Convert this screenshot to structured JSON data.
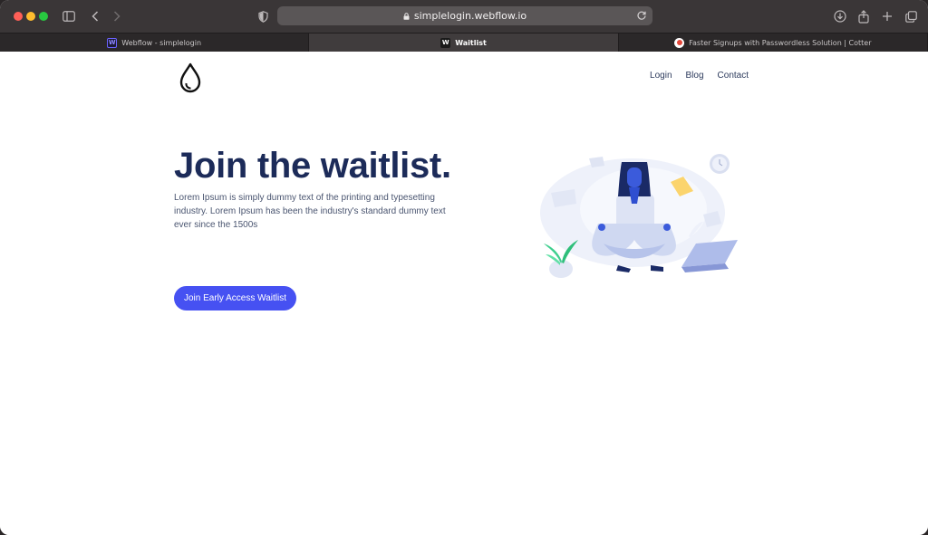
{
  "browser": {
    "url": "simplelogin.webflow.io",
    "tabs": [
      {
        "label": "Webflow - simplelogin",
        "favicon": "W",
        "active": false
      },
      {
        "label": "Waitlist",
        "favicon": "W",
        "active": true
      },
      {
        "label": "Faster Signups with Passwordless Solution | Cotter",
        "favicon": "cotter-icon",
        "active": false
      }
    ]
  },
  "nav": {
    "login": "Login",
    "blog": "Blog",
    "contact": "Contact"
  },
  "hero": {
    "title": "Join the waitlist.",
    "description": "Lorem Ipsum is simply dummy text of the printing and typesetting industry. Lorem Ipsum has been the industry's standard dummy text ever since the 1500s",
    "cta_label": "Join Early Access Waitlist"
  },
  "colors": {
    "accent": "#4651f2",
    "heading": "#1c2b59",
    "toolbar": "#3a3637"
  }
}
